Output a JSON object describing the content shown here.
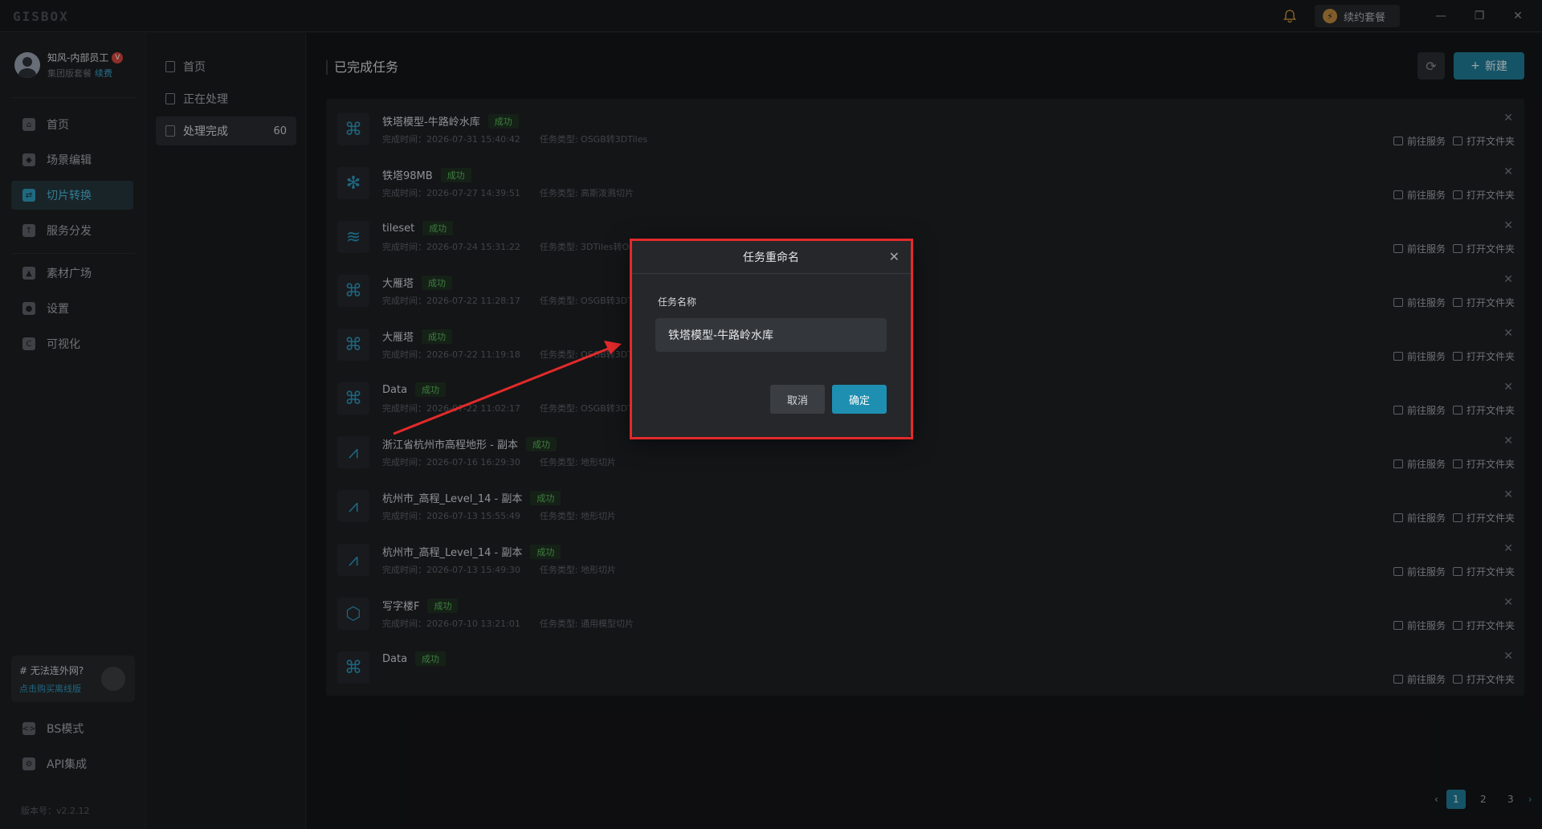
{
  "app": {
    "logo": "GISBOX"
  },
  "titlebar": {
    "renew_label": "续约套餐",
    "minimize": "—",
    "restore": "❐",
    "close": "✕"
  },
  "user": {
    "name": "知风-内部员工",
    "plan": "集团版套餐",
    "renew_link": "续费"
  },
  "nav": {
    "items": [
      {
        "label": "首页",
        "icon": "home-icon"
      },
      {
        "label": "场景编辑",
        "icon": "cube-icon"
      },
      {
        "label": "切片转换",
        "icon": "swap-icon"
      },
      {
        "label": "服务分发",
        "icon": "upload-icon"
      },
      {
        "label": "素材广场",
        "icon": "image-icon"
      },
      {
        "label": "设置",
        "icon": "gear-icon"
      },
      {
        "label": "可视化",
        "icon": "chart-icon"
      },
      {
        "label": "BS模式",
        "icon": "code-icon"
      },
      {
        "label": "API集成",
        "icon": "api-icon"
      }
    ],
    "offline": {
      "title": "# 无法连外网?",
      "link": "点击购买离线版"
    },
    "version": "版本号：v2.2.12"
  },
  "subnav": {
    "items": [
      {
        "label": "首页"
      },
      {
        "label": "正在处理"
      },
      {
        "label": "处理完成",
        "count": "60"
      }
    ]
  },
  "main": {
    "title": "已完成任务",
    "new_label": "新建",
    "actions": {
      "goto": "前往服务",
      "open": "打开文件夹"
    },
    "rows": [
      {
        "name": "铁塔模型-牛路岭水库",
        "status": "成功",
        "time": "完成时间：2026-07-31 15:40:42",
        "type": "任务类型: OSGB转3DTiles",
        "icon": "drone-icon"
      },
      {
        "name": "铁塔98MB",
        "status": "成功",
        "time": "完成时间：2026-07-27 14:39:51",
        "type": "任务类型: 高斯泼溅切片",
        "icon": "splat-icon"
      },
      {
        "name": "tileset",
        "status": "成功",
        "time": "完成时间：2026-07-24 15:31:22",
        "type": "任务类型: 3DTiles转OSGB",
        "icon": "layers-icon"
      },
      {
        "name": "大雁塔",
        "status": "成功",
        "time": "完成时间：2026-07-22 11:28:17",
        "type": "任务类型: OSGB转3DTiles",
        "icon": "drone-icon"
      },
      {
        "name": "大雁塔",
        "status": "成功",
        "time": "完成时间：2026-07-22 11:19:18",
        "type": "任务类型: OSGB转3DTiles",
        "icon": "drone-icon"
      },
      {
        "name": "Data",
        "status": "成功",
        "time": "完成时间：2026-07-22 11:02:17",
        "type": "任务类型: OSGB转3DTiles",
        "icon": "drone-icon"
      },
      {
        "name": "浙江省杭州市高程地形 - 副本",
        "status": "成功",
        "time": "完成时间：2026-07-16 16:29:30",
        "type": "任务类型: 地形切片",
        "icon": "terrain-icon"
      },
      {
        "name": "杭州市_高程_Level_14 - 副本",
        "status": "成功",
        "time": "完成时间：2026-07-13 15:55:49",
        "type": "任务类型: 地形切片",
        "icon": "terrain-icon"
      },
      {
        "name": "杭州市_高程_Level_14 - 副本",
        "status": "成功",
        "time": "完成时间：2026-07-13 15:49:30",
        "type": "任务类型: 地形切片",
        "icon": "terrain-icon"
      },
      {
        "name": "写字楼F",
        "status": "成功",
        "time": "完成时间：2026-07-10 13:21:01",
        "type": "任务类型: 通用模型切片",
        "icon": "box-icon"
      },
      {
        "name": "Data",
        "status": "成功",
        "time": "",
        "type": "",
        "icon": "drone-icon"
      }
    ],
    "pagination": {
      "pages": [
        "1",
        "2",
        "3"
      ],
      "current": "1"
    }
  },
  "dialog": {
    "title": "任务重命名",
    "field_label": "任务名称",
    "field_value": "铁塔模型-牛路岭水库",
    "cancel": "取消",
    "ok": "确定"
  },
  "colors": {
    "accent": "#1f8fb1",
    "success": "#5cb85c",
    "highlight": "#e22a2a"
  }
}
